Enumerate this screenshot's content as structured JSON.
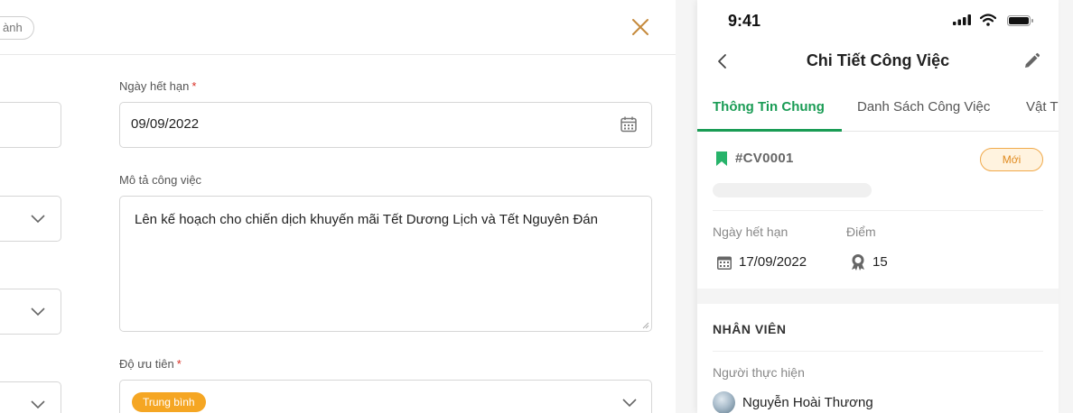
{
  "web_form": {
    "header": {
      "status_chip": "ành"
    },
    "due_date": {
      "label": "Ngày hết hạn",
      "required_mark": "*",
      "value": "09/09/2022"
    },
    "description": {
      "label": "Mô tả công việc",
      "value": "Lên kế hoạch cho chiến dịch khuyến mãi Tết Dương Lịch và Tết Nguyên Đán"
    },
    "priority": {
      "label": "Độ ưu tiên",
      "required_mark": "*",
      "value": "Trung bình",
      "badge_color": "#f5a623"
    }
  },
  "phone": {
    "status_bar": {
      "time": "9:41"
    },
    "nav": {
      "title": "Chi Tiết Công Việc"
    },
    "tabs": [
      {
        "label": "Thông Tin Chung"
      },
      {
        "label": "Danh Sách Công Việc"
      },
      {
        "label": "Vật T"
      }
    ],
    "task": {
      "code": "#CV0001",
      "status": "Mới"
    },
    "due_date": {
      "label": "Ngày hết hạn",
      "value": "17/09/2022"
    },
    "points": {
      "label": "Điểm",
      "value": "15"
    },
    "staff_section": {
      "title": "NHÂN VIÊN",
      "assignee_label": "Người thực hiện",
      "assignee_name": "Nguyễn Hoài Thương"
    },
    "colors": {
      "accent": "#1a9c55",
      "status_badge": "#f0a94a"
    }
  }
}
